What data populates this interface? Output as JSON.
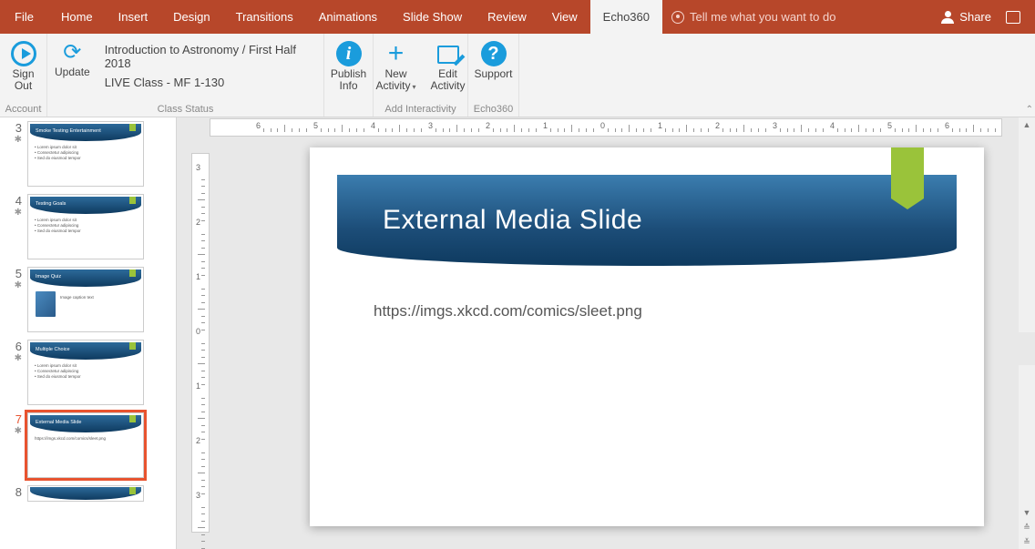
{
  "tabs": {
    "file": "File",
    "home": "Home",
    "insert": "Insert",
    "design": "Design",
    "transitions": "Transitions",
    "animations": "Animations",
    "slideshow": "Slide Show",
    "review": "Review",
    "view": "View",
    "echo360": "Echo360"
  },
  "tellme": "Tell me what you want to do",
  "share": "Share",
  "ribbon": {
    "signout": "Sign\nOut",
    "update": "Update",
    "account_group": "Account",
    "class_line1": "Introduction to Astronomy / First Half 2018",
    "class_line2": "LIVE Class - MF 1-130",
    "class_status_group": "Class Status",
    "publish": "Publish\nInfo",
    "newactivity": "New\nActivity",
    "editactivity": "Edit\nActivity",
    "interactivity_group": "Add Interactivity",
    "support": "Support",
    "echo360_group": "Echo360"
  },
  "thumbs": [
    {
      "num": "3",
      "title": "Smoke Testing Entertainment",
      "type": "bullets"
    },
    {
      "num": "4",
      "title": "Testing Goals",
      "type": "bullets"
    },
    {
      "num": "5",
      "title": "Image Quiz",
      "type": "image"
    },
    {
      "num": "6",
      "title": "Multiple Choice",
      "type": "bullets"
    },
    {
      "num": "7",
      "title": "External Media Slide",
      "type": "text",
      "selected": true
    },
    {
      "num": "8",
      "title": "",
      "type": "partial"
    }
  ],
  "slide": {
    "title": "External Media Slide",
    "body": "https://imgs.xkcd.com/comics/sleet.png"
  },
  "hruler_ticks": [
    "6",
    "5",
    "4",
    "3",
    "2",
    "1",
    "0",
    "1",
    "2",
    "3",
    "4",
    "5",
    "6"
  ],
  "vruler_ticks": [
    "3",
    "2",
    "1",
    "0",
    "1",
    "2",
    "3"
  ]
}
